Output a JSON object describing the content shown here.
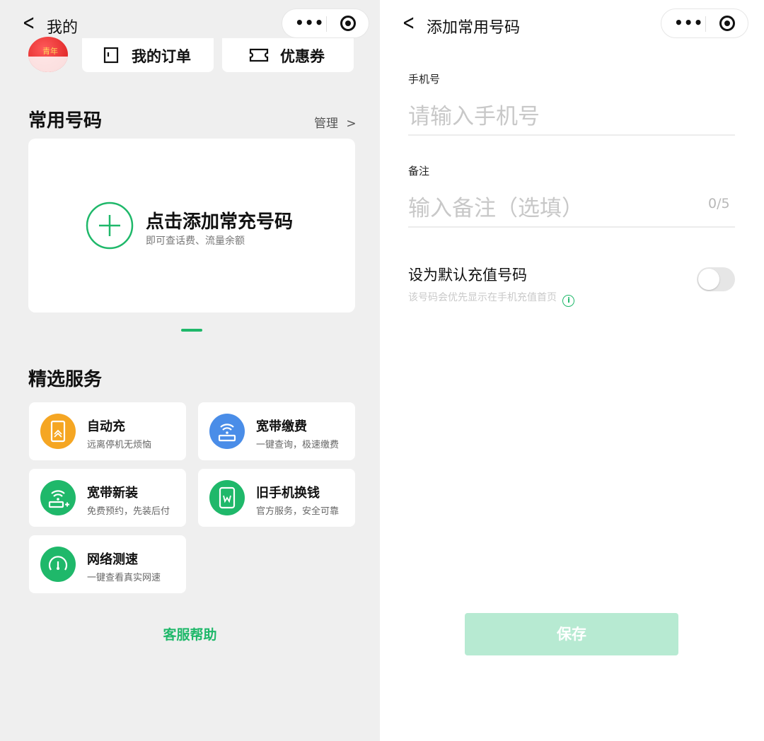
{
  "left": {
    "nav": {
      "title": "我的"
    },
    "avatar_text": "青年",
    "quick": [
      {
        "label": "我的订单"
      },
      {
        "label": "优惠券"
      }
    ],
    "common": {
      "title": "常用号码",
      "manage": "管理",
      "add_title": "点击添加常充号码",
      "add_sub": "即可查话费、流量余额"
    },
    "services_title": "精选服务",
    "services": [
      {
        "name": "自动充",
        "desc": "远离停机无烦恼",
        "icon": "phone-recharge-icon",
        "color": "#f5a623"
      },
      {
        "name": "宽带缴费",
        "desc": "一键查询，极速缴费",
        "icon": "router-icon",
        "color": "#4a8de8"
      },
      {
        "name": "宽带新装",
        "desc": "免费预约，先装后付",
        "icon": "wifi-install-icon",
        "color": "#1fb86a"
      },
      {
        "name": "旧手机换钱",
        "desc": "官方服务，安全可靠",
        "icon": "phone-trade-in-icon",
        "color": "#1fb86a"
      },
      {
        "name": "网络测速",
        "desc": "一键查看真实网速",
        "icon": "speedometer-icon",
        "color": "#1fb86a"
      }
    ],
    "help": "客服帮助"
  },
  "right": {
    "nav": {
      "title": "添加常用号码"
    },
    "phone": {
      "label": "手机号",
      "placeholder": "请输入手机号"
    },
    "note": {
      "label": "备注",
      "placeholder": "输入备注（选填）",
      "counter": "0/5"
    },
    "default": {
      "title": "设为默认充值号码",
      "desc": "该号码会优先显示在手机充值首页",
      "enabled": false
    },
    "save": "保存"
  },
  "colors": {
    "accent": "#1fb86a",
    "save_bg": "#b7ead2",
    "page_bg": "#efefef"
  }
}
